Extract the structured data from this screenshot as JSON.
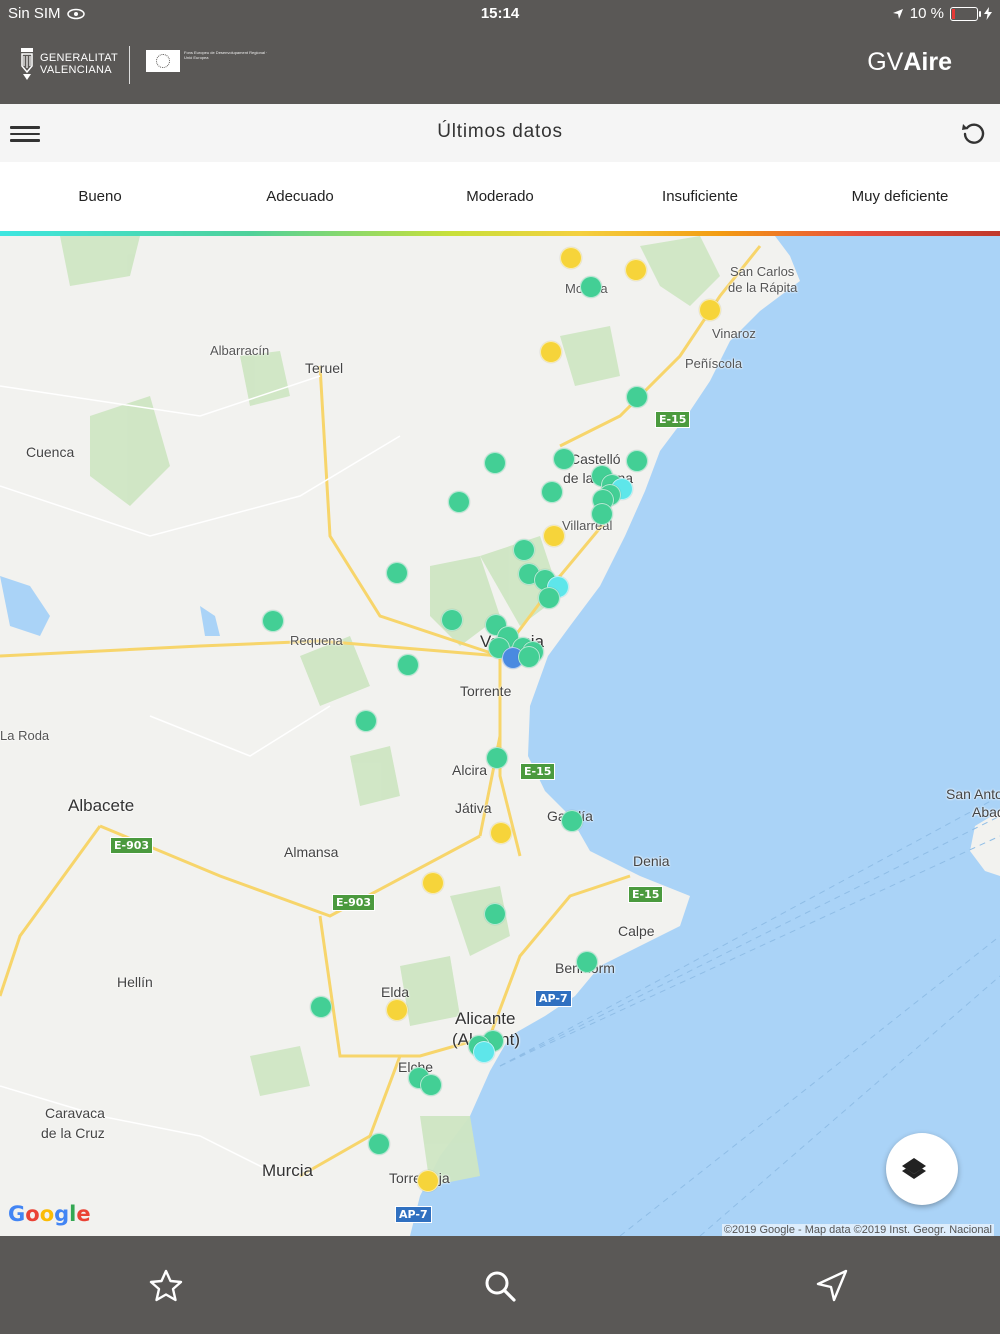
{
  "status_bar": {
    "carrier": "Sin SIM",
    "time": "15:14",
    "battery_text": "10 %",
    "icons": [
      "wifi-icon",
      "location-arrow-icon",
      "battery-icon",
      "charging-icon"
    ]
  },
  "header": {
    "org_line1": "GENERALITAT",
    "org_line2": "VALENCIANA",
    "eu_text": "Fons Europeu de Desenvolupament Regional · Unió Europea",
    "brand_light": "GV",
    "brand_bold": "Aire"
  },
  "toolbar": {
    "title": "Últimos datos",
    "menu_icon": "hamburger-menu-icon",
    "refresh_icon": "refresh-icon"
  },
  "legend": {
    "items": [
      "Bueno",
      "Adecuado",
      "Moderado",
      "Insuficiente",
      "Muy deficiente"
    ]
  },
  "map": {
    "places": {
      "san_carlos": "San Carlos",
      "de_la_rapita": "de la Rápita",
      "morella": "Morella",
      "vinaroz": "Vinaroz",
      "peniscola": "Peñíscola",
      "albarracin": "Albarracín",
      "teruel": "Teruel",
      "cuenca": "Cuenca",
      "castellon": "Castelló",
      "castellon2": "de la Plana",
      "villarreal": "Villarreal",
      "requena": "Requena",
      "valencia": "Valencia",
      "torrente": "Torrente",
      "la_roda": "La Roda",
      "alcira": "Alcira",
      "jativa": "Játiva",
      "gandia": "Gandía",
      "albacete": "Albacete",
      "almansa": "Almansa",
      "denia": "Denia",
      "calpe": "Calpe",
      "benidorm": "Benidorm",
      "hellin": "Hellín",
      "elda": "Elda",
      "alicante": "Alicante",
      "alicante2": "(Alacant)",
      "elche": "Elche",
      "caravaca": "Caravaca",
      "caravaca2": "de la Cruz",
      "murcia": "Murcia",
      "torrevieja": "Torrevieja",
      "san_antonio": "San Antoni",
      "abad": "Abad"
    },
    "roads": {
      "e15a": "E-15",
      "e15b": "E-15",
      "e15c": "E-15",
      "e903a": "E-903",
      "e903b": "E-903",
      "ap7a": "AP-7",
      "ap7b": "AP-7"
    },
    "copyright": "©2019 Google - Map data ©2019 Inst. Geogr. Nacional",
    "google_logo": "Google",
    "layers_icon": "layers-icon",
    "station_counts": {
      "green": 47,
      "yellow": 10,
      "cyan": 4
    }
  },
  "bottom_nav": {
    "icons": [
      "star-icon",
      "search-icon",
      "navigation-arrow-icon"
    ]
  },
  "colors": {
    "bar": "#5a5856",
    "good": "#43cf95",
    "moderate": "#f6d43a",
    "very_good": "#5ee6ea",
    "sea": "#aad3f7"
  }
}
